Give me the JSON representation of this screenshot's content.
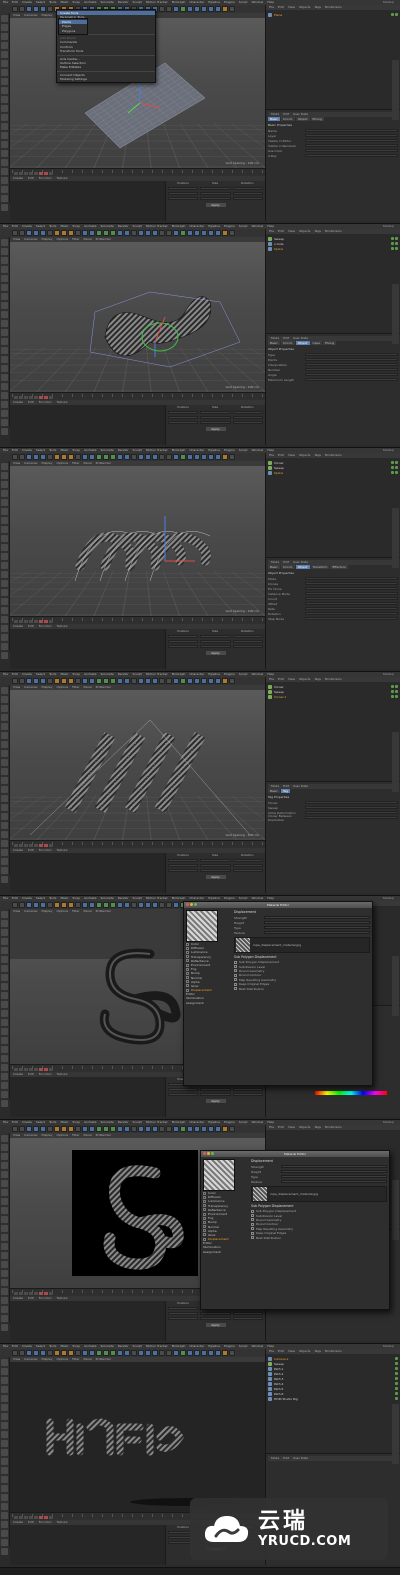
{
  "menubar": [
    "File",
    "Edit",
    "Create",
    "Select",
    "Tools",
    "Mesh",
    "Snap",
    "Animate",
    "Simulate",
    "Render",
    "Sculpt",
    "Motion Tracker",
    "MoGraph",
    "Character",
    "Pipeline",
    "Plugins",
    "Script",
    "Window",
    "Help"
  ],
  "layout_label": "Startup",
  "viewport_menu": [
    "View",
    "Cameras",
    "Display",
    "Options",
    "Filter",
    "Panel",
    "ProRender"
  ],
  "bottom_menu": [
    "Create",
    "Edit",
    "Function",
    "Texture"
  ],
  "coord_headers": [
    "Position",
    "Size",
    "Rotation"
  ],
  "apply_label": "Apply",
  "object_manager_menu": [
    "File",
    "Edit",
    "View",
    "Objects",
    "Tags",
    "Bookmarks"
  ],
  "attr_menu": [
    "Mode",
    "Edit",
    "User Data"
  ],
  "grid_spacing": "Grid Spacing : 100 cm",
  "dropdown": {
    "items": [
      {
        "label": "Create Tools",
        "shortcut": "",
        "state": "hl"
      },
      {
        "label": "Parametric Tools",
        "shortcut": "",
        "state": ""
      },
      {
        "label": "Spline",
        "shortcut": "",
        "state": ""
      },
      {
        "label": "N-Gons",
        "shortcut": "",
        "state": ""
      },
      {
        "label": "Normals",
        "shortcut": "",
        "state": ""
      },
      {
        "label": "Add Points",
        "shortcut": "",
        "state": "dim"
      },
      {
        "label": "Commands",
        "shortcut": "",
        "state": ""
      },
      {
        "label": "Conform",
        "shortcut": "",
        "state": ""
      },
      {
        "label": "Transform Tools",
        "shortcut": "",
        "state": ""
      },
      {
        "label": "Axis Center...",
        "shortcut": "",
        "state": ""
      },
      {
        "label": "Outline Selection",
        "shortcut": "",
        "state": ""
      },
      {
        "label": "Make Editable",
        "shortcut": "",
        "state": ""
      },
      {
        "label": "Connect Objects",
        "shortcut": "",
        "state": ""
      },
      {
        "label": "Modeling Settings",
        "shortcut": "",
        "state": ""
      }
    ],
    "submenu": [
      "Points",
      "Edges",
      "Polygons"
    ]
  },
  "panels": [
    {
      "objects": [
        {
          "name": "Plane",
          "icon": "blue",
          "sel": true
        }
      ],
      "attr_tabs": [
        "Basic",
        "Coord.",
        "Object",
        "Phong"
      ],
      "attr_active": 0,
      "section": "Basic Properties",
      "rows": [
        "Name",
        "Layer",
        "Visible in Editor",
        "Visible in Renderer",
        "Use Color",
        "X-Ray"
      ]
    },
    {
      "objects": [
        {
          "name": "Sweep",
          "icon": "green",
          "sel": false
        },
        {
          "name": "n-Side",
          "icon": "blue",
          "sel": false
        },
        {
          "name": "Spline",
          "icon": "blue",
          "sel": true
        }
      ],
      "attr_tabs": [
        "Basic",
        "Coord.",
        "Object",
        "Caps",
        "Phong"
      ],
      "attr_active": 2,
      "section": "Object Properties",
      "rows": [
        "Type",
        "Points",
        "Interpolation",
        "Number",
        "Angle",
        "Maximum Length"
      ]
    },
    {
      "objects": [
        {
          "name": "Cloner",
          "icon": "green",
          "sel": false
        },
        {
          "name": "Sweep",
          "icon": "green",
          "sel": false
        },
        {
          "name": "Spline",
          "icon": "blue",
          "sel": true
        }
      ],
      "attr_tabs": [
        "Basic",
        "Coord.",
        "Object",
        "Transform",
        "Effectors"
      ],
      "attr_active": 2,
      "section": "Object Properties",
      "rows": [
        "Mode",
        "Clones",
        "Fix Clone",
        "Instance Mode",
        "Count",
        "Offset",
        "Rate",
        "Rotation",
        "Step Mode"
      ]
    },
    {
      "objects": [
        {
          "name": "Cloner",
          "icon": "green",
          "sel": false
        },
        {
          "name": "Sweep",
          "icon": "green",
          "sel": false
        },
        {
          "name": "Cloner.1",
          "icon": "green",
          "sel": true
        }
      ],
      "attr_tabs": [
        "Basic",
        "Tag"
      ],
      "attr_active": 1,
      "section": "Tag Properties",
      "rows": [
        "Cloner",
        "Sweep",
        "Allow Deformation",
        "Cloner Between Duplicates"
      ]
    }
  ],
  "material_editor": {
    "title": "Material Editor",
    "channels": [
      "Color",
      "Diffusion",
      "Luminance",
      "Transparency",
      "Reflectance",
      "Environment",
      "Fog",
      "Bump",
      "Normal",
      "Alpha",
      "Glow",
      "Displacement",
      "Editor",
      "Illumination",
      "Assignment"
    ],
    "active_channel": "Displacement",
    "section": "Displacement",
    "rows": [
      "Strength",
      "Height",
      "Type",
      "Texture"
    ],
    "texture_name": "rope_displacement_material.jpg",
    "sub_section": "Sub Polygon Displacement",
    "checks": [
      "Sub Polygon Displacement",
      "Subdivision Level",
      "Round Geometry",
      "Round Contour",
      "Map Resulting Geometry",
      "Keep Original Edges",
      "Best Distribution"
    ]
  },
  "panel7_objects": [
    "Camera.1",
    "Sweep",
    "Path.1",
    "Path.2",
    "Path.3",
    "Path.4",
    "Path.5",
    "Path.6",
    "HDRI Studio Rig"
  ],
  "watermark": {
    "cn": "云瑞",
    "en": "YRUCD.COM"
  }
}
